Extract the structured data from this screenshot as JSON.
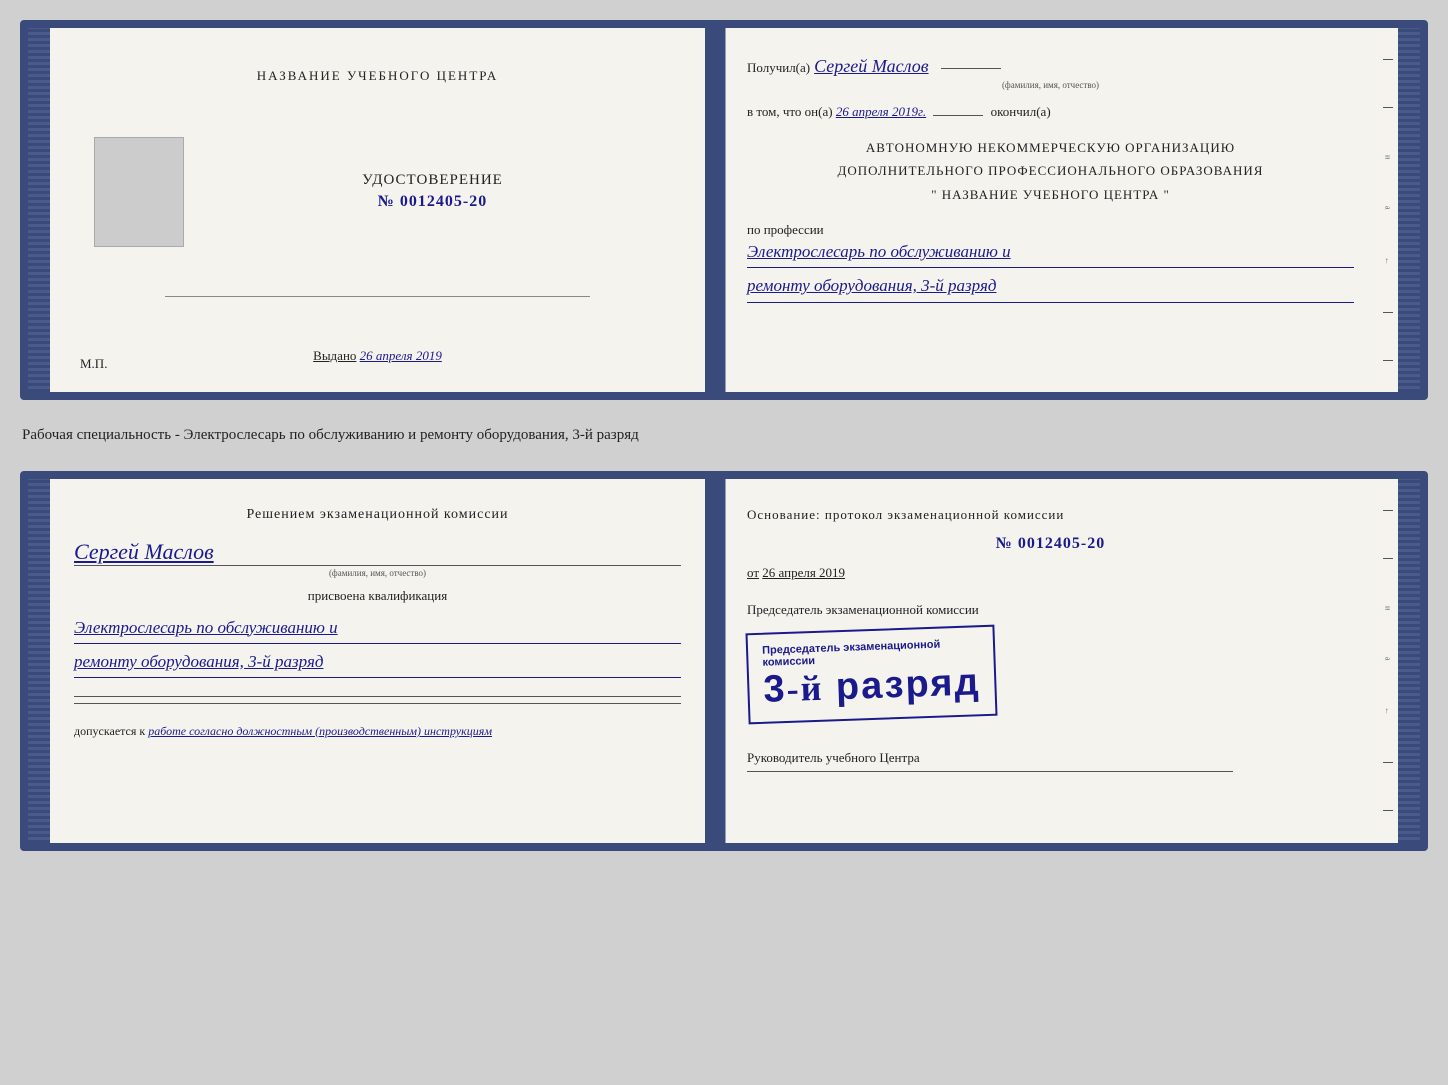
{
  "top_document": {
    "left": {
      "center_title": "НАЗВАНИЕ УЧЕБНОГО ЦЕНТРА",
      "cert_label": "УДОСТОВЕРЕНИЕ",
      "cert_number": "№ 0012405-20",
      "issued_label": "Выдано",
      "issued_date": "26 апреля 2019",
      "mp_label": "М.П."
    },
    "right": {
      "received_prefix": "Получил(а)",
      "received_name": "Сергей Маслов",
      "name_sublabel": "(фамилия, имя, отчество)",
      "completed_prefix": "в том, что он(а)",
      "completed_date": "26 апреля 2019г.",
      "completed_suffix": "окончил(а)",
      "org_line1": "АВТОНОМНУЮ НЕКОММЕРЧЕСКУЮ ОРГАНИЗАЦИЮ",
      "org_line2": "ДОПОЛНИТЕЛЬНОГО ПРОФЕССИОНАЛЬНОГО ОБРАЗОВАНИЯ",
      "org_line3": "\"   НАЗВАНИЕ УЧЕБНОГО ЦЕНТРА   \"",
      "profession_label": "по профессии",
      "profession_value1": "Электрослесарь по обслуживанию и",
      "profession_value2": "ремонту оборудования, 3-й разряд"
    }
  },
  "between_text": "Рабочая специальность - Электрослесарь по обслуживанию и ремонту оборудования, 3-й разряд",
  "bottom_document": {
    "left": {
      "decision_title": "Решением экзаменационной комиссии",
      "commission_name": "Сергей Маслов",
      "name_sublabel": "(фамилия, имя, отчество)",
      "assigned_label": "присвоена квалификация",
      "qualification_line1": "Электрослесарь по обслуживанию и",
      "qualification_line2": "ремонту оборудования, 3-й разряд",
      "allowed_prefix": "допускается к",
      "allowed_value": "работе согласно должностным (производственным) инструкциям"
    },
    "right": {
      "basis_title": "Основание: протокол экзаменационной комиссии",
      "basis_number": "№  0012405-20",
      "basis_date_prefix": "от",
      "basis_date": "26 апреля 2019",
      "chairman_label": "Председатель экзаменационной комиссии",
      "stamp_main": "3-й разряд",
      "stamp_prefix": "3-й",
      "stamp_word": "разряд",
      "director_label": "Руководитель учебного Центра"
    }
  },
  "edge_labels": {
    "и": "и",
    "а": "а",
    "arrow": "←",
    "dash1": "–",
    "dash2": "–",
    "dash3": "–",
    "dash4": "–"
  }
}
